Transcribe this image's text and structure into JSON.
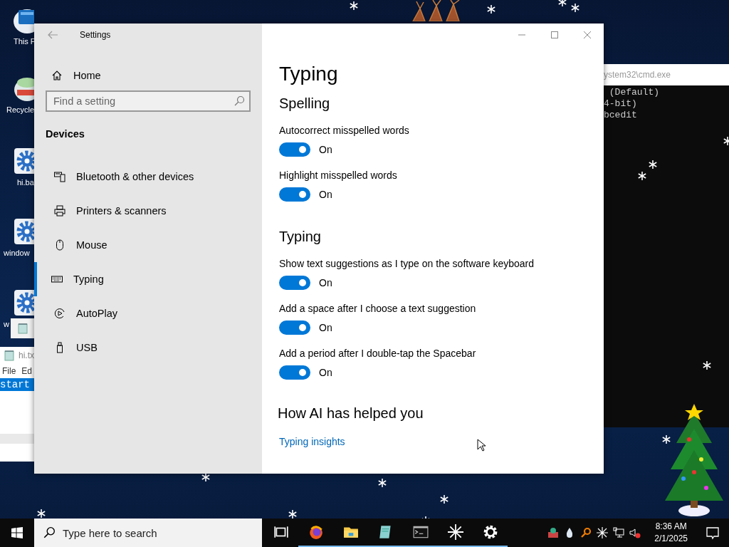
{
  "desktop_icons": [
    {
      "kind": "pc",
      "label": "This P"
    },
    {
      "kind": "recycle",
      "label": "Recycle"
    },
    {
      "kind": "gear",
      "label": "hi.ba"
    },
    {
      "kind": "gear",
      "label": "window"
    },
    {
      "kind": "gear",
      "label": "w"
    }
  ],
  "notepad": {
    "title": "hi.tx",
    "menu": [
      "File",
      "Ed"
    ],
    "text": "start"
  },
  "cmd": {
    "title": "ystem32\\cmd.exe",
    "lines": [
      " (Default)",
      "4-bit)",
      "bcedit"
    ]
  },
  "settings": {
    "title": "Settings",
    "home": "Home",
    "search": {
      "placeholder": "Find a setting"
    },
    "section": "Devices",
    "nav": [
      {
        "kind": "bluetooth",
        "label": "Bluetooth & other devices",
        "selected": false
      },
      {
        "kind": "printer",
        "label": "Printers & scanners",
        "selected": false
      },
      {
        "kind": "mouse",
        "label": "Mouse",
        "selected": false
      },
      {
        "kind": "keyboard",
        "label": "Typing",
        "selected": true
      },
      {
        "kind": "autoplay",
        "label": "AutoPlay",
        "selected": false
      },
      {
        "kind": "usb",
        "label": "USB",
        "selected": false
      }
    ],
    "page_title": "Typing",
    "groups": [
      {
        "heading": "Spelling",
        "settings": [
          {
            "label": "Autocorrect misspelled words",
            "on": true,
            "state": "On"
          },
          {
            "label": "Highlight misspelled words",
            "on": true,
            "state": "On"
          }
        ]
      },
      {
        "heading": "Typing",
        "settings": [
          {
            "label": "Show text suggestions as I type on the software keyboard",
            "on": true,
            "state": "On"
          },
          {
            "label": "Add a space after I choose a text suggestion",
            "on": true,
            "state": "On"
          },
          {
            "label": "Add a period after I double-tap the Spacebar",
            "on": true,
            "state": "On"
          }
        ]
      }
    ],
    "ai_heading": "How AI has helped you",
    "ai_link": "Typing insights"
  },
  "taskbar": {
    "search": {
      "placeholder": "Type here to search"
    },
    "apps": [
      {
        "kind": "taskview",
        "running": false
      },
      {
        "kind": "browser",
        "running": true
      },
      {
        "kind": "folder",
        "running": true
      },
      {
        "kind": "notepad",
        "running": true
      },
      {
        "kind": "terminal",
        "running": true
      },
      {
        "kind": "star",
        "running": true
      },
      {
        "kind": "gear",
        "running": true
      }
    ],
    "time": "8:36 AM",
    "date": "2/1/2025"
  }
}
